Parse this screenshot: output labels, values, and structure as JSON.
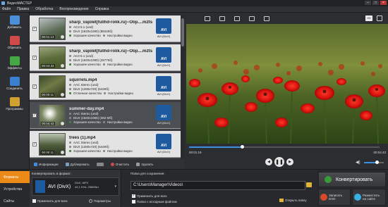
{
  "window": {
    "title": "ВидеоМАСТЕР"
  },
  "menu": [
    "Файл",
    "Правка",
    "Обработка",
    "Воспроизведение",
    "Справка"
  ],
  "sidebar": [
    {
      "label": "Добавить",
      "icon": "add-icon",
      "color": "#4a8fd8"
    },
    {
      "label": "Обрезать",
      "icon": "cut-icon",
      "color": "#d04a4a"
    },
    {
      "label": "Эффекты",
      "icon": "effects-icon",
      "color": "#45a845"
    },
    {
      "label": "Соединить",
      "icon": "join-icon",
      "color": "#3a7fd0"
    },
    {
      "label": "Программы",
      "icon": "programs-icon",
      "color": "#d0a030"
    }
  ],
  "files": [
    {
      "name": "sharp_vajolet[fullhd-rolik.ru]--Обр....m2ts",
      "duration": "00:01:13",
      "audio": "AC3 5.1 (und)",
      "video": "DivX (1920x1080) (8844Кб)",
      "quality": "Хорошее качество",
      "settings": "Настройки видео",
      "format": "AVI",
      "format_sub": "AVI (DivX)",
      "selected": false
    },
    {
      "name": "sharp_vajolet[fullhd-rolik.ru]--Обр....m2ts",
      "duration": "00:04:33",
      "audio": "AC3 5.1 (und)",
      "video": "DivX (1920x1080) (2577Кб)",
      "quality": "Хорошее качество",
      "settings": "Настройки видео",
      "format": "AVI",
      "format_sub": "AVI (DivX)",
      "selected": false
    },
    {
      "name": "squirrels.mp4",
      "duration": "00:00:11",
      "audio": "AAC Stereo (und)",
      "video": "DivX (1280x720) (644Кб)",
      "quality": "Отличное качество",
      "settings": "Настройки видео",
      "format": "AVI",
      "format_sub": "AVI (DivX)",
      "selected": false
    },
    {
      "name": "summer-day.mp4",
      "duration": "00:04:43",
      "audio": "AAC Stereo (und)",
      "video": "DivX (1920x1080) (382 Мб)",
      "quality": "Хорошее качество",
      "settings": "Настройки видео",
      "format": "AVI",
      "format_sub": "AVI (DivX)",
      "selected": true
    },
    {
      "name": "trees (1).mp4",
      "duration": "00:00:11",
      "audio": "AAC Stereo (und)",
      "video": "DivX (1280x720) (544Кб)",
      "quality": "Хорошее качество",
      "settings": "Настройки видео",
      "format": "AVI",
      "format_sub": "AVI (DivX)",
      "selected": false
    }
  ],
  "listbar": {
    "info": "Информация",
    "duplicate": "Дублировать",
    "clear": "Очистить",
    "delete": "Удалить"
  },
  "player": {
    "current": "00:01:19",
    "total": "00:04:43",
    "progress": 0.28,
    "volume": 0.65
  },
  "bottom": {
    "tabs": [
      "Форматы",
      "Устройства",
      "Сайты"
    ],
    "convert_label": "Конвертировать в формат:",
    "format_name": "AVI (DivX)",
    "format_details": [
      "DivX, MP3",
      "44,1 KHz, 256Кбит"
    ],
    "apply_all": "Применить для всех",
    "params": "Параметры",
    "save_label": "Папка для сохранения:",
    "save_path": "C:\\Users\\Manager\\Videos\\",
    "apply_all2": "Применить для всех",
    "source_folder": "Папка с исходным файлом",
    "open_folder": "Открыть папку",
    "convert_btn": "Конвертировать",
    "dvd_btn": [
      "Записать",
      "DVD"
    ],
    "web_btn": [
      "Разместить",
      "на сайте"
    ]
  }
}
